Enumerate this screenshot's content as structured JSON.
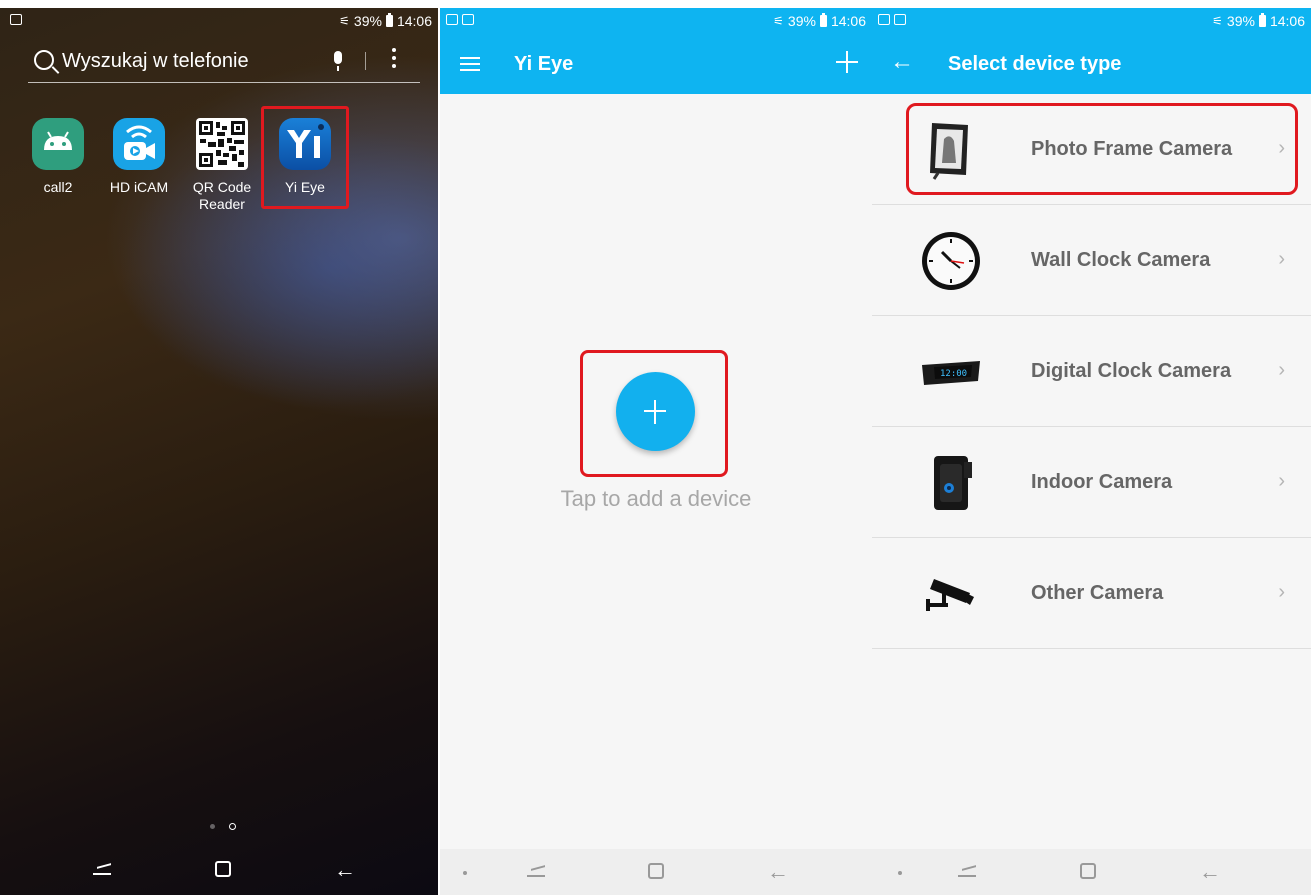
{
  "status": {
    "battery": "39%",
    "time": "14:06"
  },
  "launcher": {
    "search_placeholder": "Wyszukaj w telefonie",
    "apps": [
      {
        "label": "call2"
      },
      {
        "label": "HD iCAM"
      },
      {
        "label": "QR Code Reader"
      },
      {
        "label": "Yi Eye"
      }
    ]
  },
  "yieye": {
    "title": "Yi Eye",
    "tap_text": "Tap to add a device"
  },
  "device_type": {
    "title": "Select device type",
    "items": [
      {
        "label": "Photo Frame Camera",
        "icon": "photo-frame-camera-icon"
      },
      {
        "label": "Wall Clock Camera",
        "icon": "wall-clock-camera-icon"
      },
      {
        "label": "Digital Clock Camera",
        "icon": "digital-clock-camera-icon",
        "display": "12:00"
      },
      {
        "label": "Indoor Camera",
        "icon": "indoor-camera-icon"
      },
      {
        "label": "Other Camera",
        "icon": "cctv-camera-icon"
      }
    ]
  },
  "colors": {
    "accent": "#0eb4f1",
    "highlight": "#e0191f"
  }
}
